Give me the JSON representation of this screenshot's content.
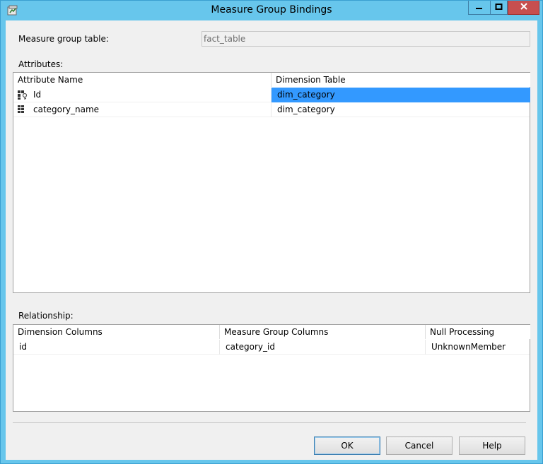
{
  "window": {
    "title": "Measure Group Bindings"
  },
  "measure_group": {
    "label": "Measure group table:",
    "value": "fact_table"
  },
  "attributes": {
    "label": "Attributes:",
    "columns": [
      "Attribute Name",
      "Dimension Table"
    ],
    "rows": [
      {
        "name": "Id",
        "table": "dim_category",
        "icon": "key-attribute-icon",
        "selected": true
      },
      {
        "name": "category_name",
        "table": "dim_category",
        "icon": "attribute-icon",
        "selected": false
      }
    ]
  },
  "relationship": {
    "label": "Relationship:",
    "columns": [
      "Dimension Columns",
      "Measure Group Columns",
      "Null Processing"
    ],
    "rows": [
      {
        "dimension_column": "id",
        "measure_group_column": "category_id",
        "null_processing": "UnknownMember"
      }
    ]
  },
  "buttons": {
    "ok": "OK",
    "cancel": "Cancel",
    "help": "Help"
  },
  "colors": {
    "titlebar": "#67c6ec",
    "selection": "#3399ff",
    "close_button": "#c74f4f"
  }
}
